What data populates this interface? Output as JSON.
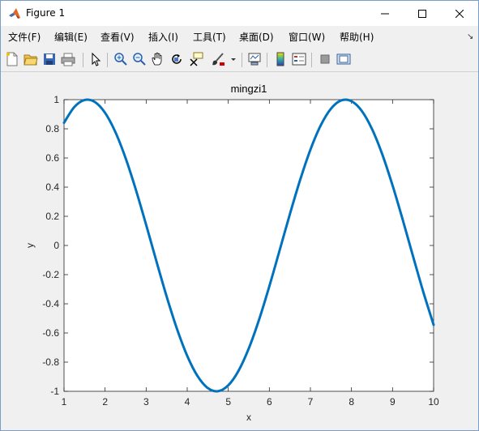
{
  "window": {
    "title": "Figure 1"
  },
  "icons": {
    "app": "matlab-icon",
    "minimize": "minimize-icon",
    "maximize": "maximize-icon",
    "close": "close-icon"
  },
  "menu": {
    "items": [
      "文件(F)",
      "编辑(E)",
      "查看(V)",
      "插入(I)",
      "工具(T)",
      "桌面(D)",
      "窗口(W)",
      "帮助(H)"
    ]
  },
  "toolbar": {
    "buttons": [
      "new-figure-icon",
      "open-file-icon",
      "save-icon",
      "print-icon",
      "pointer-icon",
      "zoom-in-icon",
      "zoom-out-icon",
      "pan-icon",
      "rotate-3d-icon",
      "data-cursor-icon",
      "brush-icon",
      "link-plot-icon",
      "insert-colorbar-icon",
      "insert-legend-icon",
      "hide-plot-tools-icon",
      "show-plot-tools-icon"
    ]
  },
  "colors": {
    "line": "#0072bd",
    "axes_bg": "#ffffff",
    "figure_bg": "#f0f0f0"
  },
  "chart_data": {
    "type": "line",
    "title": "mingzi1",
    "xlabel": "x",
    "ylabel": "y",
    "xlim": [
      1,
      10
    ],
    "ylim": [
      -1,
      1
    ],
    "xticks": [
      1,
      2,
      3,
      4,
      5,
      6,
      7,
      8,
      9,
      10
    ],
    "yticks": [
      -1,
      -0.8,
      -0.6,
      -0.4,
      -0.2,
      0,
      0.2,
      0.4,
      0.6,
      0.8,
      1
    ],
    "grid": false,
    "series": [
      {
        "x": [
          1.0,
          1.25,
          1.5,
          1.75,
          2.0,
          2.25,
          2.5,
          2.75,
          3.0,
          3.25,
          3.5,
          3.75,
          4.0,
          4.25,
          4.5,
          4.75,
          5.0,
          5.25,
          5.5,
          5.75,
          6.0,
          6.25,
          6.5,
          6.75,
          7.0,
          7.25,
          7.5,
          7.75,
          8.0,
          8.25,
          8.5,
          8.75,
          9.0,
          9.25,
          9.5,
          9.75,
          10.0
        ],
        "y": [
          0.8415,
          0.949,
          0.9975,
          0.984,
          0.9093,
          0.7781,
          0.5985,
          0.3817,
          0.1411,
          -0.1082,
          -0.3508,
          -0.5716,
          -0.7568,
          -0.895,
          -0.9775,
          -0.9993,
          -0.9589,
          -0.8589,
          -0.7055,
          -0.5083,
          -0.2794,
          -0.0332,
          0.2151,
          0.45,
          0.657,
          0.8231,
          0.938,
          0.9946,
          0.9894,
          0.9228,
          0.7985,
          0.6247,
          0.4121,
          0.1743,
          -0.0752,
          -0.3195,
          -0.544
        ],
        "color": "#0072bd"
      }
    ]
  }
}
